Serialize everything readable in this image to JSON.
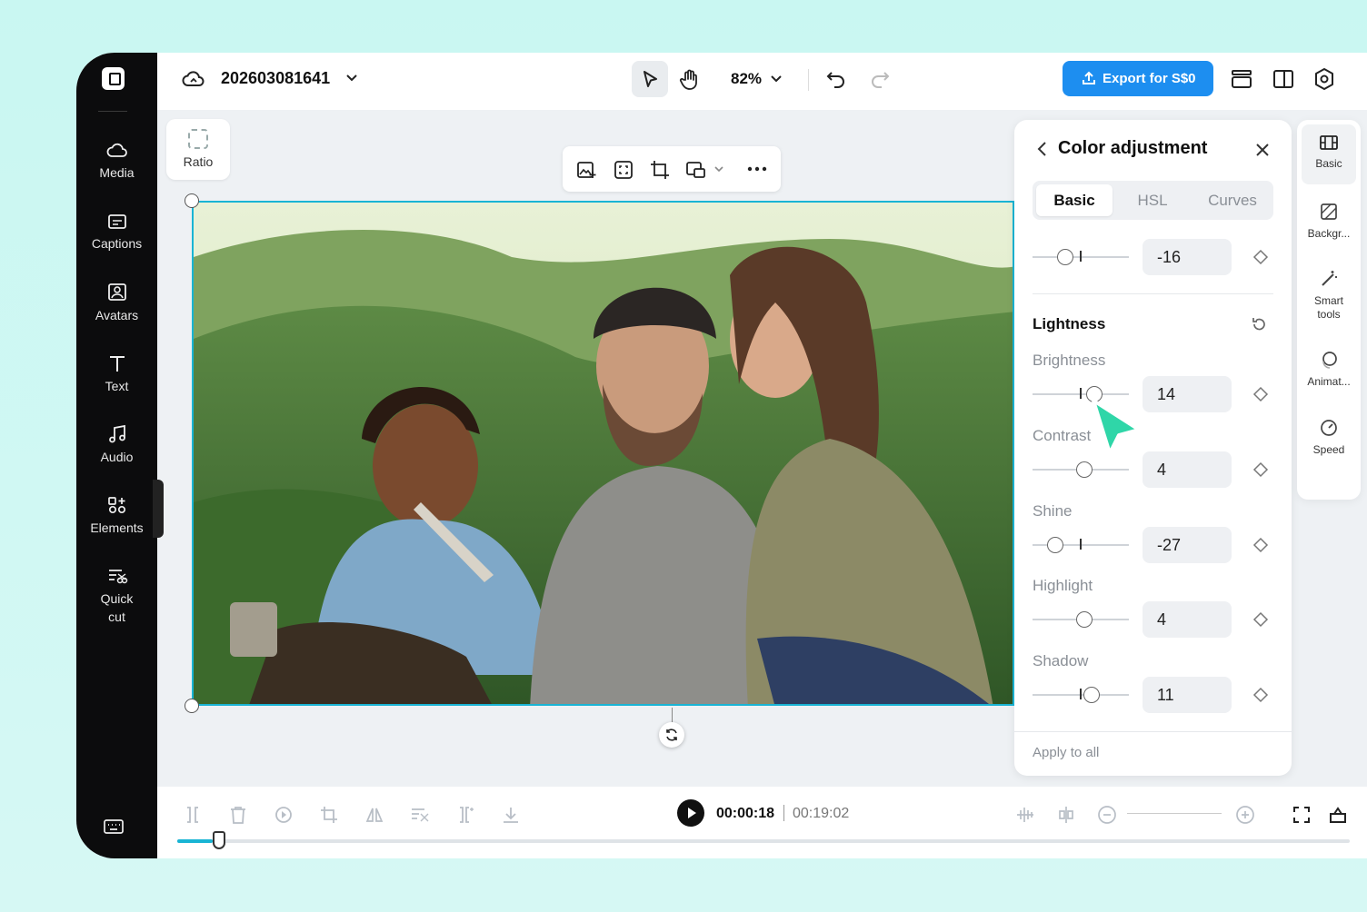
{
  "sidebar": {
    "items": [
      {
        "label": "Media",
        "icon": "cloud-icon"
      },
      {
        "label": "Captions",
        "icon": "captions-icon"
      },
      {
        "label": "Avatars",
        "icon": "avatar-icon"
      },
      {
        "label": "Text",
        "icon": "text-icon"
      },
      {
        "label": "Audio",
        "icon": "music-icon"
      },
      {
        "label": "Elements",
        "icon": "elements-icon"
      },
      {
        "label": "Quick",
        "label2": "cut",
        "icon": "quick-cut-icon"
      }
    ]
  },
  "header": {
    "project_title": "202603081641",
    "zoom": "82%",
    "export_label": "Export for S$0"
  },
  "canvas": {
    "ratio_label": "Ratio"
  },
  "panel": {
    "title": "Color adjustment",
    "tabs": [
      "Basic",
      "HSL",
      "Curves"
    ],
    "active_tab": "Basic",
    "top_value": "-16",
    "section_title": "Lightness",
    "sliders": [
      {
        "label": "Brightness",
        "value": "14",
        "level": 14
      },
      {
        "label": "Contrast",
        "value": "4",
        "level": 4
      },
      {
        "label": "Shine",
        "value": "-27",
        "level": -27
      },
      {
        "label": "Highlight",
        "value": "4",
        "level": 4
      },
      {
        "label": "Shadow",
        "value": "11",
        "level": 11
      }
    ],
    "apply_label": "Apply to all"
  },
  "rail": {
    "items": [
      {
        "label": "Basic",
        "icon": "film-icon"
      },
      {
        "label": "Backgr...",
        "icon": "background-icon"
      },
      {
        "label": "Smart",
        "label2": "tools",
        "icon": "magic-wand-icon"
      },
      {
        "label": "Animat...",
        "icon": "animation-icon"
      },
      {
        "label": "Speed",
        "icon": "speed-icon"
      }
    ]
  },
  "timeline": {
    "current_time": "00:00:18",
    "total_time": "00:19:02",
    "progress": 0.03
  },
  "colors": {
    "accent": "#19b4d4",
    "export_button": "#1d8ef0",
    "sidebar_bg": "#0c0c0d",
    "cursor": "#2fd6a8"
  }
}
